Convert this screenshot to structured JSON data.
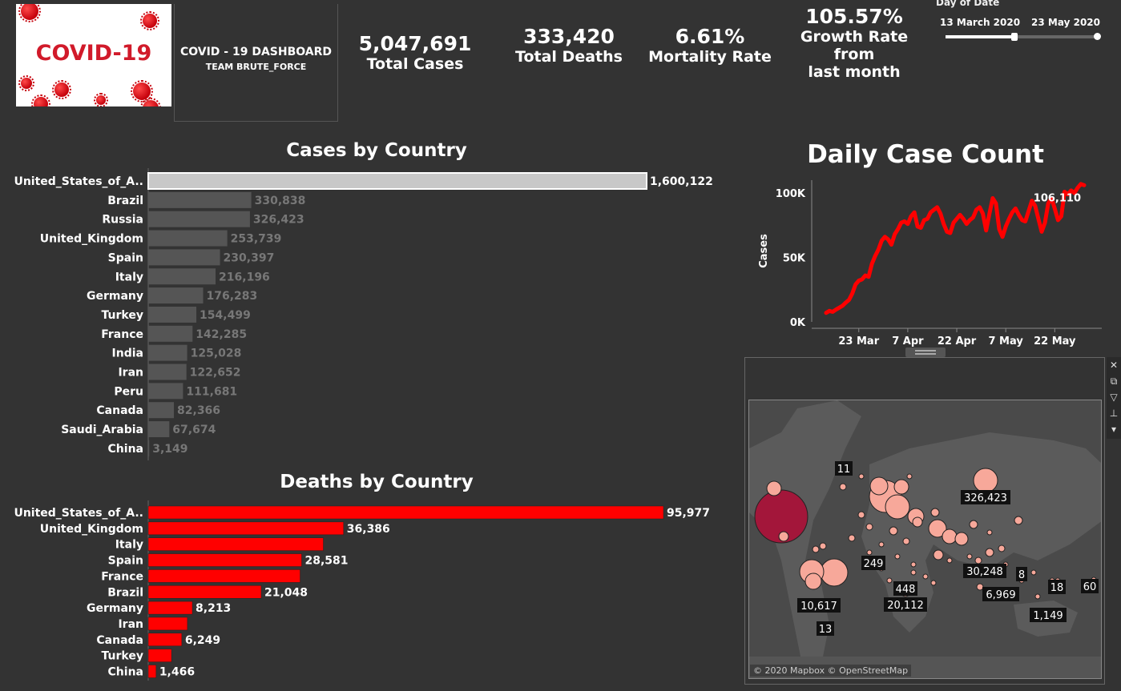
{
  "logo": {
    "text": "COVID-19"
  },
  "header": {
    "title": "COVID - 19 DASHBOARD",
    "subtitle": "TEAM BRUTE_FORCE"
  },
  "kpis": {
    "total_cases": {
      "value": "5,047,691",
      "label": "Total Cases"
    },
    "total_deaths": {
      "value": "333,420",
      "label": "Total Deaths"
    },
    "mortality": {
      "value": "6.61%",
      "label": "Mortality Rate"
    },
    "growth": {
      "value": "105.57%",
      "label_line1": "Growth Rate from",
      "label_line2": "last month"
    }
  },
  "date_filter": {
    "title": "Day of Date",
    "start": "13 March 2020",
    "end": "23 May 2020",
    "selected_fraction": 0.45
  },
  "colors": {
    "background": "#333333",
    "bar_highlight": "#c8c8c8",
    "bar_default": "#555555",
    "death_bar": "#ff0000",
    "line": "#ff0000",
    "bubble_light": "#f7a89a",
    "bubble_dark": "#a3163a"
  },
  "chart_data": [
    {
      "type": "bar",
      "title": "Cases by Country",
      "orientation": "horizontal",
      "categories": [
        "United_States_of_A..",
        "Brazil",
        "Russia",
        "United_Kingdom",
        "Spain",
        "Italy",
        "Germany",
        "Turkey",
        "France",
        "India",
        "Iran",
        "Peru",
        "Canada",
        "Saudi_Arabia",
        "China"
      ],
      "values": [
        1600122,
        330838,
        326423,
        253739,
        230397,
        216196,
        176283,
        154499,
        142285,
        125028,
        122652,
        111681,
        82366,
        67674,
        3149
      ],
      "value_labels": [
        "1,600,122",
        "330,838",
        "326,423",
        "253,739",
        "230,397",
        "216,196",
        "176,283",
        "154,499",
        "142,285",
        "125,028",
        "122,652",
        "111,681",
        "82,366",
        "67,674",
        "3,149"
      ],
      "highlighted": "United_States_of_A.."
    },
    {
      "type": "bar",
      "title": "Deaths by Country",
      "orientation": "horizontal",
      "categories": [
        "United_States_of_A..",
        "United_Kingdom",
        "Italy",
        "Spain",
        "France",
        "Brazil",
        "Germany",
        "Iran",
        "Canada",
        "Turkey",
        "China"
      ],
      "values": [
        95977,
        36386,
        32616,
        28581,
        28289,
        21048,
        8213,
        7300,
        6249,
        4340,
        1466
      ],
      "value_labels": [
        "95,977",
        "36,386",
        "",
        "28,581",
        "",
        "21,048",
        "8,213",
        "",
        "6,249",
        "",
        "1,466"
      ]
    },
    {
      "type": "line",
      "title": "Daily Case Count",
      "ylabel": "Cases",
      "xlabel": "",
      "x_ticks": [
        "23 Mar",
        "7 Apr",
        "22 Apr",
        "7 May",
        "22 May"
      ],
      "y_ticks": [
        "0K",
        "50K",
        "100K"
      ],
      "ylim": [
        0,
        110000
      ],
      "x_start": "2020-03-13",
      "end_label": "106,110",
      "values": [
        7000,
        8500,
        7800,
        9500,
        11000,
        12500,
        15000,
        17000,
        22000,
        29000,
        32000,
        33000,
        36000,
        35000,
        45000,
        51000,
        56000,
        63000,
        66000,
        64000,
        60000,
        68000,
        72000,
        77000,
        78000,
        76000,
        82000,
        85000,
        74000,
        73000,
        79000,
        80000,
        85000,
        87000,
        89000,
        84000,
        76000,
        70000,
        69000,
        77000,
        80000,
        83000,
        80000,
        76000,
        79000,
        81000,
        87000,
        89000,
        84000,
        71000,
        84000,
        96000,
        92000,
        72000,
        66000,
        74000,
        80000,
        85000,
        88000,
        83000,
        79000,
        78000,
        86000,
        94000,
        90000,
        80000,
        70000,
        77000,
        92000,
        96000,
        88000,
        79000,
        82000,
        101000,
        99000,
        102000,
        100000,
        104000,
        107000,
        106110
      ]
    },
    {
      "type": "scatter",
      "title": "",
      "map": true,
      "labels": [
        "11",
        "326,423",
        "249",
        "30,248",
        "8",
        "18",
        "60",
        "6,969",
        "1,149",
        "448",
        "20,112",
        "10,617",
        "13"
      ],
      "attribution": "© 2020 Mapbox © OpenStreetMap"
    }
  ]
}
